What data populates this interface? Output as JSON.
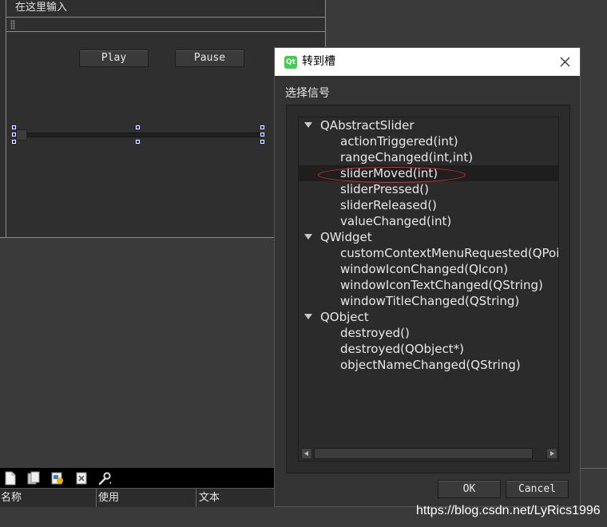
{
  "designer": {
    "menu_placeholder": "在这里输入",
    "play_label": "Play",
    "pause_label": "Pause"
  },
  "dialog": {
    "title": "转到槽",
    "signal_label": "选择信号",
    "ok_label": "OK",
    "cancel_label": "Cancel",
    "tree": [
      {
        "kind": "group",
        "label": "QAbstractSlider"
      },
      {
        "kind": "signal",
        "label": "actionTriggered(int)"
      },
      {
        "kind": "signal",
        "label": "rangeChanged(int,int)"
      },
      {
        "kind": "signal",
        "label": "sliderMoved(int)",
        "selected": true
      },
      {
        "kind": "signal",
        "label": "sliderPressed()"
      },
      {
        "kind": "signal",
        "label": "sliderReleased()"
      },
      {
        "kind": "signal",
        "label": "valueChanged(int)"
      },
      {
        "kind": "group",
        "label": "QWidget"
      },
      {
        "kind": "signal",
        "label": "customContextMenuRequested(QPoint)"
      },
      {
        "kind": "signal",
        "label": "windowIconChanged(QIcon)"
      },
      {
        "kind": "signal",
        "label": "windowIconTextChanged(QString)"
      },
      {
        "kind": "signal",
        "label": "windowTitleChanged(QString)"
      },
      {
        "kind": "group",
        "label": "QObject"
      },
      {
        "kind": "signal",
        "label": "destroyed()"
      },
      {
        "kind": "signal",
        "label": "destroyed(QObject*)"
      },
      {
        "kind": "signal",
        "label": "objectNameChanged(QString)"
      }
    ]
  },
  "resource_table": {
    "headers": [
      "名称",
      "使用",
      "文本"
    ]
  },
  "watermark": "https://blog.csdn.net/LyRics1996",
  "colors": {
    "qt_green": "#41cd52",
    "annotation_red": "#e0302a",
    "selection_handle": "#1414ff"
  }
}
